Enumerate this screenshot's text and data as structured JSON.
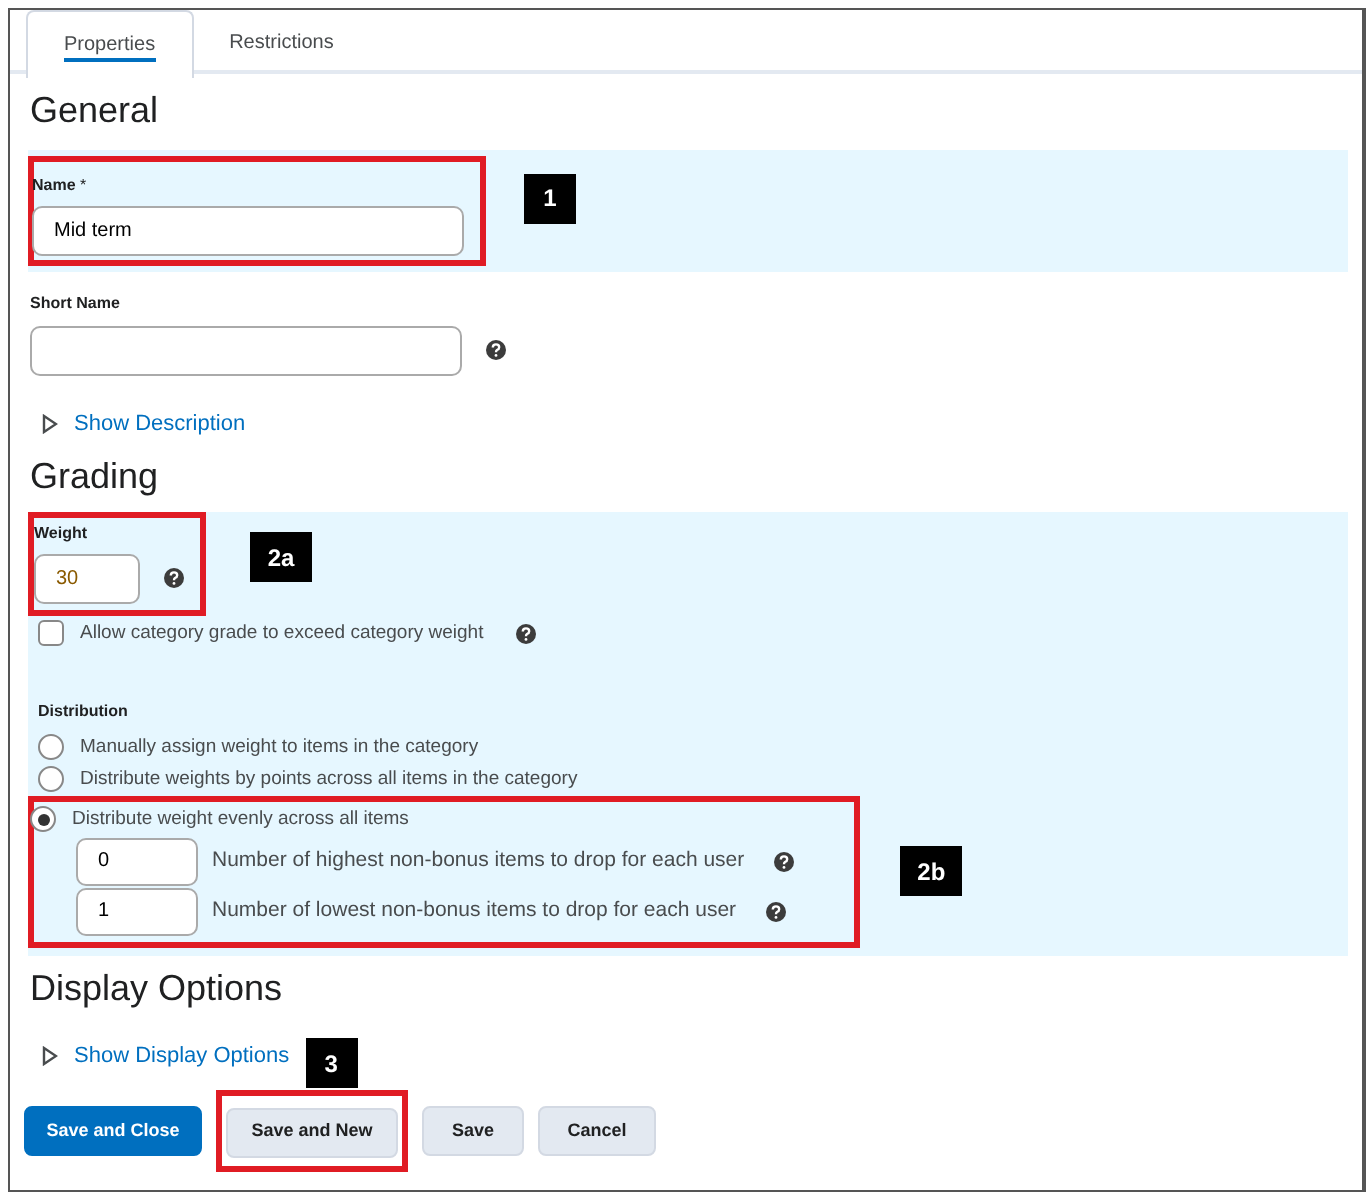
{
  "tabs": [
    {
      "label": "Properties",
      "selected": true
    },
    {
      "label": "Restrictions",
      "selected": false
    }
  ],
  "general": {
    "title": "General",
    "name": {
      "label": "Name",
      "required_mark": "*",
      "value": "Mid term",
      "highlighted": true,
      "callout": "1"
    },
    "short_name": {
      "label": "Short Name"
    },
    "toggle": "Show Description"
  },
  "grading": {
    "title": "Grading",
    "weight": {
      "label": "Weight",
      "value": "30",
      "highlighted": true,
      "callout": "2a"
    },
    "exceed": {
      "label": "Allow category grade to exceed category weight",
      "checked": false
    },
    "distribution": {
      "label": "Distribution",
      "highlighted": true,
      "callout": "2b",
      "options": [
        {
          "label": "Manually assign weight to items in the category",
          "selected": false
        },
        {
          "label": "Distribute weights by points across all items in the category",
          "selected": false
        },
        {
          "label": "Distribute weight evenly across all items",
          "selected": true
        }
      ],
      "drop_rows": [
        {
          "value": "0",
          "label": "Number of highest non-bonus items to drop for each user"
        },
        {
          "value": "1",
          "label": "Number of lowest non-bonus items to drop for each user"
        }
      ]
    }
  },
  "display_options": {
    "title": "Display Options",
    "toggle": "Show Display Options",
    "callout": "3"
  },
  "buttons": [
    {
      "label": "Save and Close",
      "kind": "primary",
      "highlighted": false
    },
    {
      "label": "Save and New",
      "kind": "secondary",
      "highlighted": true
    },
    {
      "label": "Save",
      "kind": "secondary",
      "highlighted": false
    },
    {
      "label": "Cancel",
      "kind": "secondary",
      "highlighted": false
    }
  ]
}
